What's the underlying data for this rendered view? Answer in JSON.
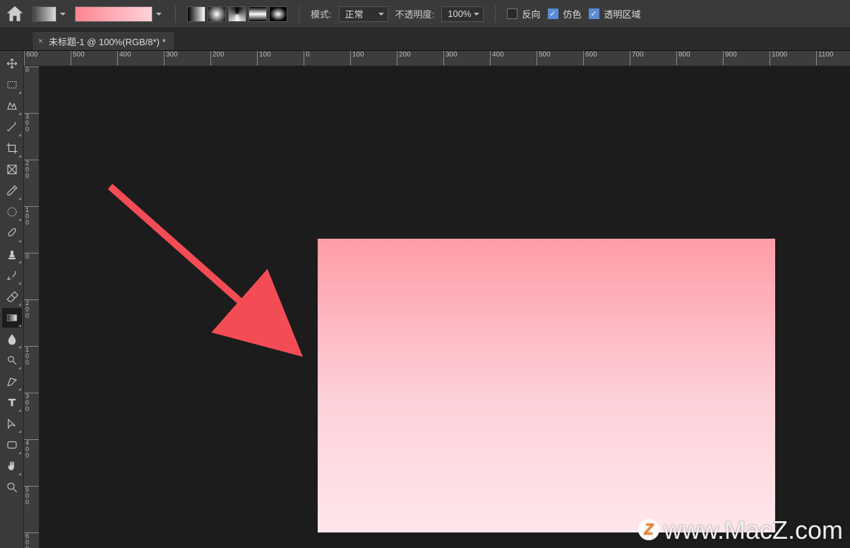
{
  "options_bar": {
    "mode_label": "模式:",
    "mode_value": "正常",
    "opacity_label": "不透明度:",
    "opacity_value": "100%",
    "reverse": {
      "label": "反向",
      "checked": false
    },
    "dither": {
      "label": "仿色",
      "checked": true
    },
    "transparency": {
      "label": "透明区域",
      "checked": true
    }
  },
  "tab": {
    "title": "未标题-1 @ 100%(RGB/8*) *",
    "close": "×"
  },
  "ruler_h": [
    "600",
    "500",
    "400",
    "300",
    "200",
    "100",
    "0",
    "100",
    "200",
    "300",
    "400",
    "500",
    "600",
    "700",
    "800",
    "900",
    "1000",
    "1100"
  ],
  "ruler_v": [
    "0",
    "300",
    "200",
    "100",
    "0",
    "200",
    "100",
    "300",
    "400",
    "500",
    "600"
  ],
  "watermark": "www.MacZ.com",
  "gradient": {
    "from": "#fc8590",
    "to": "#ffd2da"
  },
  "tools": {
    "move": "Move",
    "marquee": "Marquee",
    "lasso": "Lasso",
    "wand": "Magic Wand",
    "crop": "Crop",
    "frame": "Frame",
    "eyedrop": "Eyedropper",
    "healing": "Spot Heal",
    "brush": "Brush",
    "stamp": "Clone Stamp",
    "history": "History Brush",
    "eraser": "Eraser",
    "gradient": "Gradient",
    "blur": "Blur",
    "dodge": "Dodge",
    "pen": "Pen",
    "text": "Text",
    "path": "Path Select",
    "shape": "Rectangle",
    "hand": "Hand",
    "zoom": "Zoom"
  }
}
